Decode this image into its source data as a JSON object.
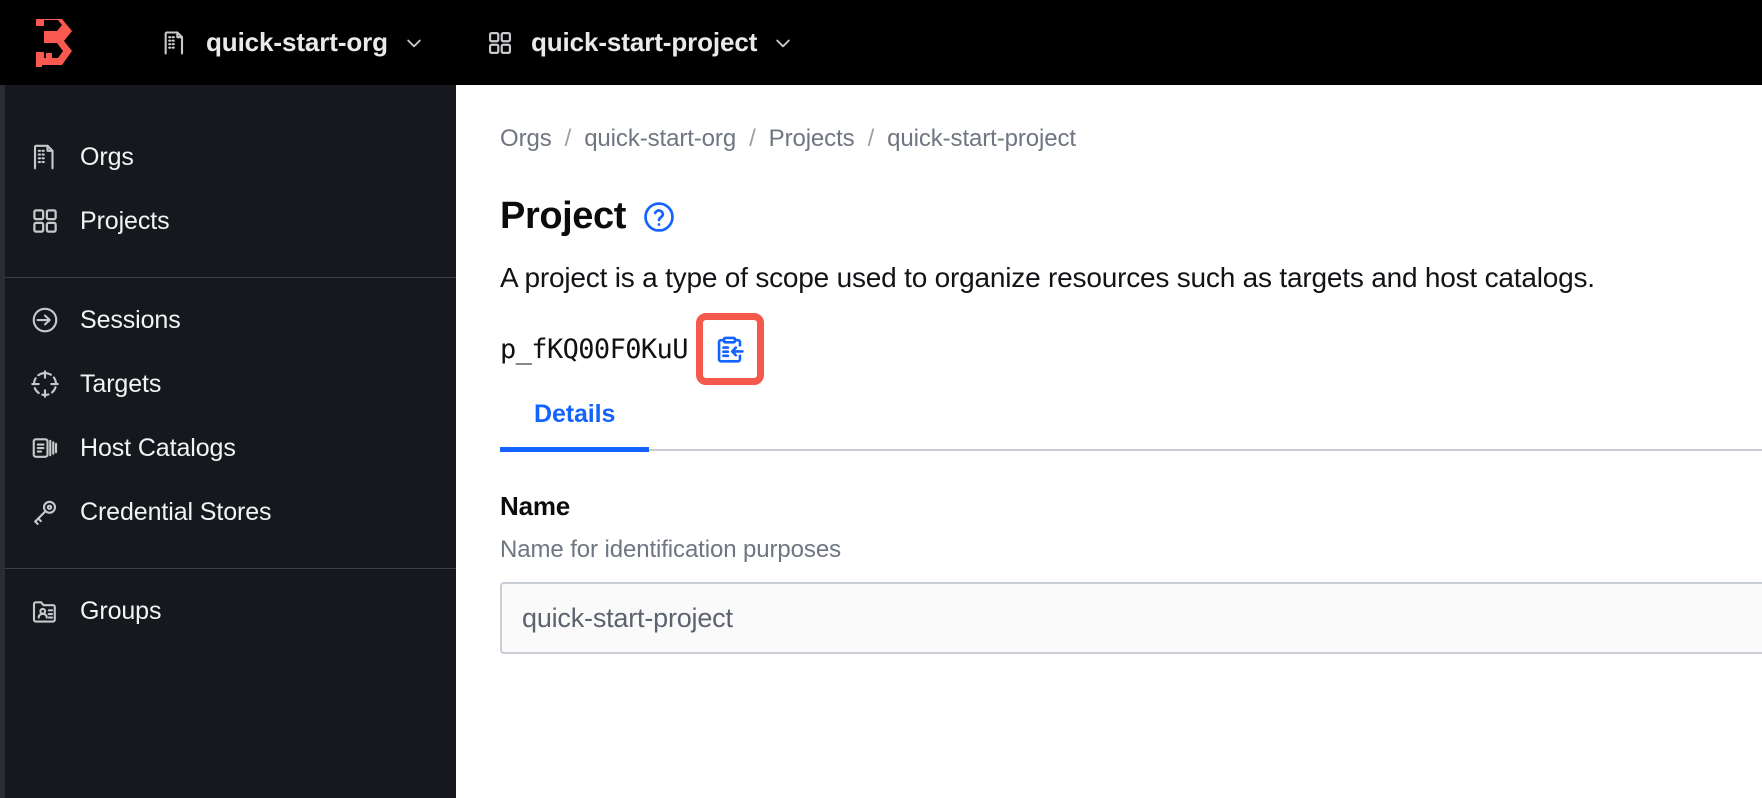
{
  "topbar": {
    "logo_name": "boundary-logo",
    "logo_color": "#f9594e",
    "background": "#000000",
    "org_switcher": {
      "icon": "building-icon",
      "label": "quick-start-org",
      "chevron": "chevron-down-icon"
    },
    "project_switcher": {
      "icon": "grid-icon",
      "label": "quick-start-project",
      "chevron": "chevron-down-icon"
    }
  },
  "sidebar": {
    "background": "#16181d",
    "groups": [
      {
        "items": [
          {
            "icon": "building-icon",
            "label": "Orgs"
          },
          {
            "icon": "grid-icon",
            "label": "Projects"
          }
        ]
      },
      {
        "items": [
          {
            "icon": "sessions-arrow-icon",
            "label": "Sessions"
          },
          {
            "icon": "crosshair-icon",
            "label": "Targets"
          },
          {
            "icon": "server-icon",
            "label": "Host Catalogs"
          },
          {
            "icon": "key-icon",
            "label": "Credential Stores"
          }
        ]
      },
      {
        "items": [
          {
            "icon": "folder-users-icon",
            "label": "Groups"
          }
        ]
      }
    ]
  },
  "main": {
    "breadcrumb": {
      "items": [
        "Orgs",
        "quick-start-org",
        "Projects",
        "quick-start-project"
      ],
      "separator": "/"
    },
    "page_title": "Project",
    "help_icon": "help-circle-icon",
    "description": "A project is a type of scope used to organize resources such as targets and host catalogs.",
    "resource_id": "p_fKQ00F0KuU",
    "copy_button": {
      "icon": "clipboard-copy-icon",
      "color": "#1563ff",
      "highlighted": true,
      "highlight_color": "#f4594c"
    },
    "tabs": [
      {
        "label": "Details",
        "active": true
      }
    ],
    "form": {
      "name_field": {
        "label": "Name",
        "help": "Name for identification purposes",
        "value": "quick-start-project",
        "placeholder": "Name"
      }
    }
  }
}
